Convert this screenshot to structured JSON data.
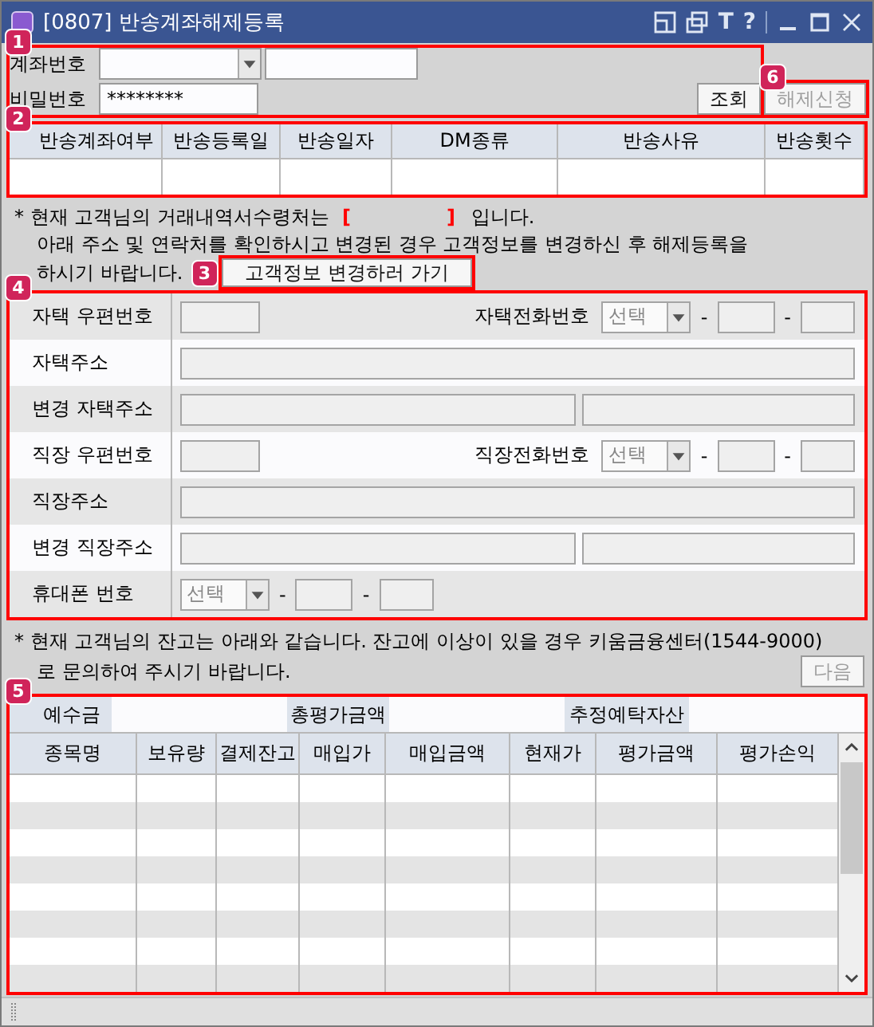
{
  "window": {
    "title": "[0807] 반송계좌해제등록",
    "glyphs": [
      "T",
      "?"
    ]
  },
  "callouts": [
    "1",
    "2",
    "3",
    "4",
    "5",
    "6"
  ],
  "account": {
    "label": "계좌번호",
    "password_label": "비밀번호",
    "password_value": "********",
    "search_button": "조회",
    "release_button": {
      "label": "해제신청",
      "disabled": true
    }
  },
  "return_grid": {
    "columns": [
      "반송계좌여부",
      "반송등록일",
      "반송일자",
      "DM종류",
      "반송사유",
      "반송횟수"
    ]
  },
  "notice": {
    "before": "* 현재 고객님의 거래내역서수령처는",
    "bracket_open": "[",
    "bracket_close": "]",
    "after": "입니다.",
    "line2": "아래 주소 및 연락처를 확인하시고 변경된 경우 고객정보를 변경하신 후 해제등록을",
    "line3": "하시기 바랍니다.",
    "button": "고객정보 변경하러 가기"
  },
  "form": [
    {
      "kind": "postal_phone",
      "label": "자택 우편번호",
      "phone_label": "자택전화번호",
      "select": "선택",
      "separators": [
        "-",
        "-"
      ]
    },
    {
      "kind": "address",
      "label": "자택주소"
    },
    {
      "kind": "address_split",
      "label": "변경 자택주소"
    },
    {
      "kind": "postal_phone",
      "label": "직장 우편번호",
      "phone_label": "직장전화번호",
      "select": "선택",
      "separators": [
        "-",
        "-"
      ]
    },
    {
      "kind": "address",
      "label": "직장주소"
    },
    {
      "kind": "address_split",
      "label": "변경 직장주소"
    },
    {
      "kind": "mobile",
      "label": "휴대폰 번호",
      "select": "선택",
      "separators": [
        "-",
        "-"
      ]
    }
  ],
  "balance_notice": {
    "line1": "* 현재 고객님의 잔고는 아래와 같습니다. 잔고에 이상이 있을 경우 키움금융센터(1544-9000)",
    "line2": "로 문의하여 주시기 바랍니다.",
    "next_button": {
      "label": "다음",
      "disabled": true
    }
  },
  "summary": [
    "예수금",
    "총평가금액",
    "추정예탁자산"
  ],
  "holdings_grid": {
    "columns": [
      "종목명",
      "보유량",
      "결제잔고",
      "매입가",
      "매입금액",
      "현재가",
      "평가금액",
      "평가손익"
    ]
  }
}
